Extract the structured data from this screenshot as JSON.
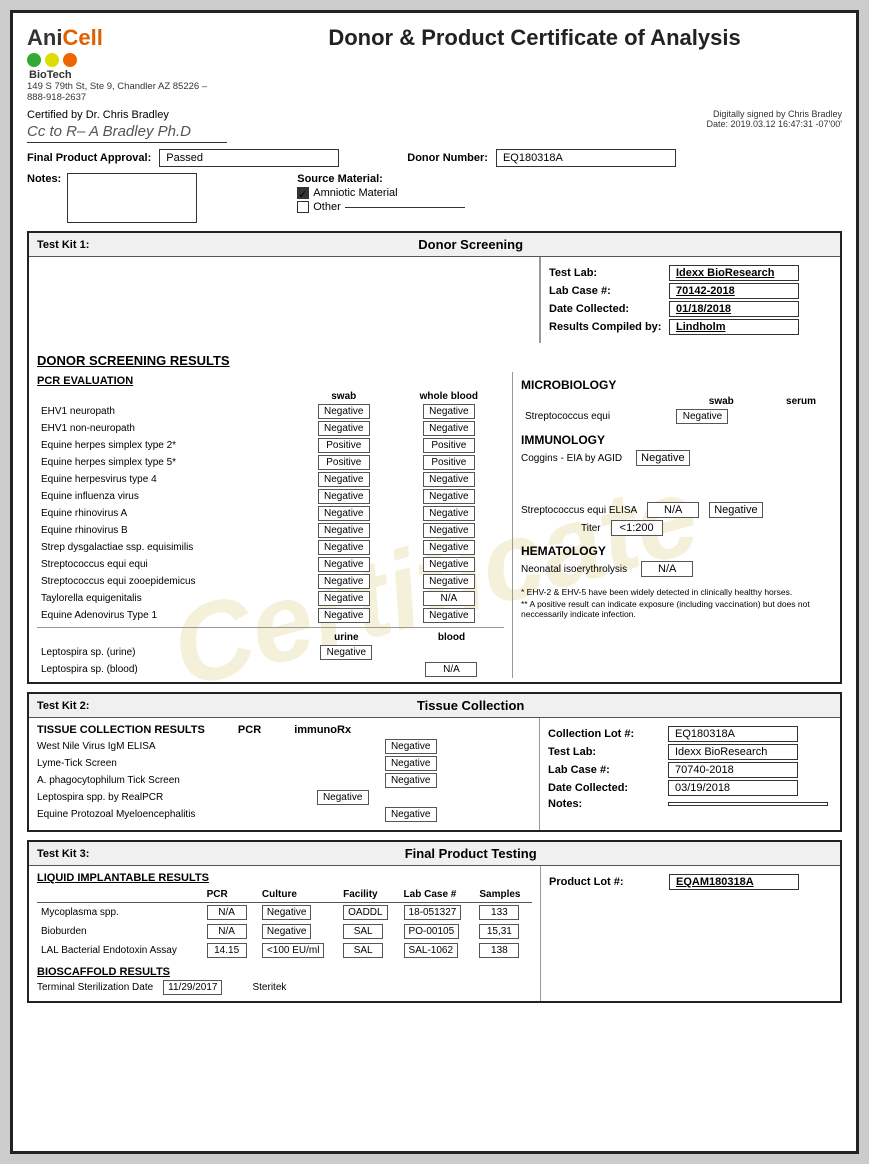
{
  "header": {
    "logo_ani": "Ani",
    "logo_cell": "Cell",
    "logo_biotech": "BioTech",
    "logo_address": "149 S 79th St, Ste 9, Chandler AZ 85226 – 888-918-2637",
    "main_title": "Donor & Product Certificate of Analysis",
    "certified_by": "Certified by Dr. Chris Bradley",
    "signature_text": "Cc to R– A Bradley Ph.D",
    "digital_sig_line1": "Digitally signed by Chris Bradley",
    "digital_sig_line2": "Date: 2019.03.12 16:47:31 -07'00'"
  },
  "final_approval": {
    "label": "Final Product Approval:",
    "value": "Passed",
    "donor_number_label": "Donor Number:",
    "donor_number": "EQ180318A"
  },
  "notes": {
    "label": "Notes:",
    "source_label": "Source Material:",
    "amniotic": "Amniotic Material",
    "other": "Other"
  },
  "kit1": {
    "kit_label": "Test Kit 1:",
    "kit_title": "Donor Screening",
    "test_lab_label": "Test Lab:",
    "test_lab": "Idexx BioResearch",
    "lab_case_label": "Lab Case #:",
    "lab_case": "70142-2018",
    "date_collected_label": "Date Collected:",
    "date_collected": "01/18/2018",
    "results_compiled_label": "Results Compiled by:",
    "results_compiled": "Lindholm",
    "donor_results_heading": "DONOR SCREENING RESULTS",
    "pcr_heading": "PCR EVALUATION",
    "pcr_col1": "swab",
    "pcr_col2": "whole blood",
    "pcr_rows": [
      {
        "name": "EHV1 neuropath",
        "swab": "Negative",
        "blood": "Negative"
      },
      {
        "name": "EHV1 non-neuropath",
        "swab": "Negative",
        "blood": "Negative"
      },
      {
        "name": "Equine herpes simplex type 2*",
        "swab": "Positive",
        "blood": "Positive"
      },
      {
        "name": "Equine herpes simplex type 5*",
        "swab": "Positive",
        "blood": "Positive"
      },
      {
        "name": "Equine herpesvirus type 4",
        "swab": "Negative",
        "blood": "Negative"
      },
      {
        "name": "Equine influenza virus",
        "swab": "Negative",
        "blood": "Negative"
      },
      {
        "name": "Equine rhinovirus A",
        "swab": "Negative",
        "blood": "Negative"
      },
      {
        "name": "Equine rhinovirus B",
        "swab": "Negative",
        "blood": "Negative"
      },
      {
        "name": "Strep dysgalactiae ssp. equisimilis",
        "swab": "Negative",
        "blood": "Negative"
      },
      {
        "name": "Streptococcus equi equi",
        "swab": "Negative",
        "blood": "Negative"
      },
      {
        "name": "Streptococcus equi zooepidemicus",
        "swab": "Negative",
        "blood": "Negative"
      },
      {
        "name": "Taylorella equigenitalis",
        "swab": "Negative",
        "blood": "N/A"
      },
      {
        "name": "Equine Adenovirus Type 1",
        "swab": "Negative",
        "blood": "Negative"
      }
    ],
    "pcr_urine_col": "urine",
    "pcr_blood_col": "blood",
    "leptospira_urine": [
      {
        "name": "Leptospira sp. (urine)",
        "val": "Negative"
      },
      {
        "name": "Leptospira sp. (blood)",
        "val": "N/A"
      }
    ],
    "micro_heading": "MICROBIOLOGY",
    "micro_col1": "swab",
    "micro_col2": "serum",
    "micro_rows": [
      {
        "name": "Streptococcus equi",
        "swab": "Negative",
        "serum": ""
      }
    ],
    "immuno_heading": "IMMUNOLOGY",
    "coggins_label": "Coggins - EIA by AGID",
    "coggins_val": "Negative",
    "strep_elisa_label": "Streptococcus equi ELISA",
    "strep_elisa_val1": "N/A",
    "strep_elisa_val2": "Negative",
    "titer_label": "Titer",
    "titer_val": "<1:200",
    "hema_heading": "HEMATOLOGY",
    "neonatal_label": "Neonatal isoerythrolysis",
    "neonatal_val": "N/A",
    "footnote1": "* EHV-2 & EHV-5 have been widely detected in clinically healthy horses.",
    "footnote2": "** A positive result can indicate exposure (including vaccination) but does not neccessarily indicate infection."
  },
  "kit2": {
    "kit_label": "Test Kit 2:",
    "kit_title": "Tissue Collection",
    "collection_lot_label": "Collection Lot #:",
    "collection_lot": "EQ180318A",
    "test_lab_label": "Test Lab:",
    "test_lab": "Idexx BioResearch",
    "lab_case_label": "Lab Case #:",
    "lab_case": "70740-2018",
    "date_collected_label": "Date Collected:",
    "date_collected": "03/19/2018",
    "notes_label": "Notes:",
    "notes_val": "",
    "results_heading": "TISSUE COLLECTION RESULTS",
    "pcr_col": "PCR",
    "immunorx_col": "immunoRx",
    "tissue_rows": [
      {
        "name": "West Nile Virus IgM ELISA",
        "pcr": "",
        "immunorx": "Negative"
      },
      {
        "name": "Lyme-Tick Screen",
        "pcr": "",
        "immunorx": "Negative"
      },
      {
        "name": "A. phagocytophilum Tick Screen",
        "pcr": "",
        "immunorx": "Negative"
      },
      {
        "name": "Leptospira spp. by RealPCR",
        "pcr": "Negative",
        "immunorx": ""
      },
      {
        "name": "Equine Protozoal Myeloencephalitis",
        "pcr": "",
        "immunorx": "Negative"
      }
    ]
  },
  "kit3": {
    "kit_label": "Test Kit 3:",
    "kit_title": "Final Product Testing",
    "product_lot_label": "Product Lot #:",
    "product_lot": "EQAM180318A",
    "results_heading": "LIQUID IMPLANTABLE RESULTS",
    "pcr_col": "PCR",
    "culture_col": "Culture",
    "facility_col": "Facility",
    "lab_case_col": "Lab Case #",
    "samples_col": "Samples",
    "liquid_rows": [
      {
        "name": "Mycoplasma spp.",
        "pcr": "N/A",
        "culture": "Negative",
        "facility": "OADDL",
        "lab_case": "18-051327",
        "samples": "133"
      },
      {
        "name": "Bioburden",
        "pcr": "N/A",
        "culture": "Negative",
        "facility": "SAL",
        "lab_case": "PO-00105",
        "samples": "15,31"
      },
      {
        "name": "LAL Bacterial Endotoxin Assay",
        "pcr": "14.15",
        "culture": "<100 EU/ml",
        "facility": "SAL",
        "lab_case": "SAL-1062",
        "samples": "138"
      }
    ],
    "bioscaffold_heading": "BIOSCAFFOLD RESULTS",
    "terminal_label": "Terminal Sterilization Date",
    "terminal_val": "11/29/2017",
    "sterilizer": "Steritek"
  }
}
